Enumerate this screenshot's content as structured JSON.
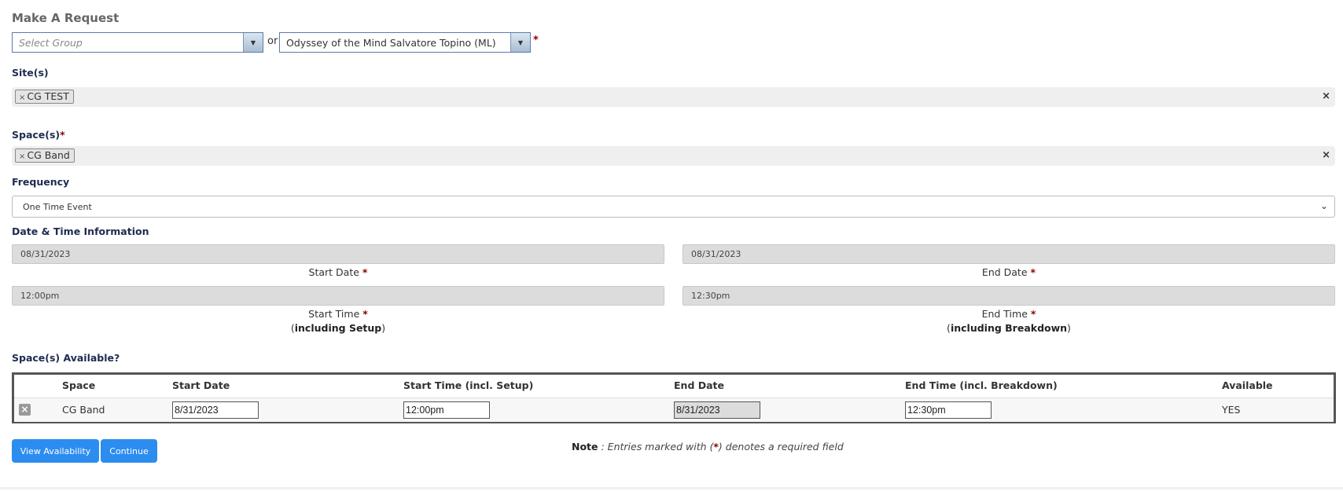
{
  "title": "Make A Request",
  "group_select": {
    "placeholder": "Select Group"
  },
  "or_text": "or",
  "organization_select": {
    "value": "Odyssey of the Mind Salvatore Topino (ML)"
  },
  "required_mark": "*",
  "sites": {
    "label": "Site(s)",
    "tags": [
      "CG TEST"
    ],
    "tag_remove": "×",
    "clear_all": "×"
  },
  "spaces": {
    "label": "Space(s)",
    "tags": [
      "CG Band"
    ],
    "tag_remove": "×",
    "clear_all": "×"
  },
  "frequency": {
    "label": "Frequency",
    "value": "One Time Event",
    "chevron": "⌄"
  },
  "datetime": {
    "label": "Date & Time Information",
    "start_date": {
      "value": "08/31/2023",
      "caption": "Start Date"
    },
    "end_date": {
      "value": "08/31/2023",
      "caption": "End Date"
    },
    "start_time": {
      "value": "12:00pm",
      "caption": "Start Time",
      "sub_open": "(",
      "sub_bold": "including Setup",
      "sub_close": ")"
    },
    "end_time": {
      "value": "12:30pm",
      "caption": "End Time",
      "sub_open": "(",
      "sub_bold": "including Breakdown",
      "sub_close": ")"
    }
  },
  "availability": {
    "label": "Space(s) Available?",
    "columns": [
      "Space",
      "Start Date",
      "Start Time (incl. Setup)",
      "End Date",
      "End Time (incl. Breakdown)",
      "Available"
    ],
    "rows": [
      {
        "remove_icon": "×",
        "space": "CG Band",
        "start_date": "8/31/2023",
        "start_time": "12:00pm",
        "end_date": "8/31/2023",
        "end_time": "12:30pm",
        "available": "YES"
      }
    ]
  },
  "buttons": {
    "view_availability": "View Availability",
    "continue": "Continue"
  },
  "note": {
    "bold": "Note",
    "text_before": " : Entries marked with (",
    "mark": "*",
    "text_after": ") denotes a required field"
  },
  "colors": {
    "primary_button": "#2d8cf0",
    "required": "#8b0000",
    "label": "#1d2b4f"
  }
}
